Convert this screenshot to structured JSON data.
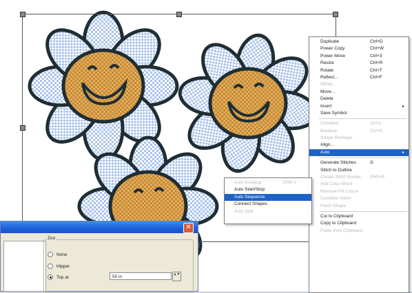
{
  "context_menu": {
    "items": [
      {
        "label": "Duplicate",
        "shortcut": "Ctrl+D",
        "disabled": false
      },
      {
        "label": "Power Copy",
        "shortcut": "Ctrl+W",
        "disabled": false
      },
      {
        "label": "Power Move",
        "shortcut": "Ctrl+3",
        "disabled": false
      },
      {
        "label": "Resize",
        "shortcut": "Ctrl+R",
        "disabled": false
      },
      {
        "label": "Rotate",
        "shortcut": "Ctrl+T",
        "disabled": false
      },
      {
        "label": "Reflect...",
        "shortcut": "Ctrl+F",
        "disabled": false
      },
      {
        "label": "Offset...",
        "shortcut": "",
        "disabled": true
      },
      {
        "label": "Move...",
        "shortcut": "",
        "disabled": false
      },
      {
        "label": "Delete",
        "shortcut": "",
        "disabled": false
      },
      {
        "label": "Insert",
        "shortcut": "",
        "disabled": false,
        "submenu": true
      },
      {
        "label": "Save Symbol",
        "shortcut": "",
        "disabled": false
      },
      {
        "separator": true
      },
      {
        "label": "Combine",
        "shortcut": "Ctrl+L",
        "disabled": true
      },
      {
        "label": "Breakup",
        "shortcut": "Ctrl+K",
        "disabled": true
      },
      {
        "label": "Shape Reshape",
        "shortcut": "",
        "disabled": true
      },
      {
        "label": "Align...",
        "shortcut": "",
        "disabled": false
      },
      {
        "label": "Auto",
        "shortcut": "",
        "disabled": false,
        "highlight": true,
        "submenu": true
      },
      {
        "separator": true
      },
      {
        "label": "Generate Stitches",
        "shortcut": "G",
        "disabled": false
      },
      {
        "label": "Stitch to Outline",
        "shortcut": "",
        "disabled": false
      },
      {
        "label": "Create Stitch Border",
        "shortcut": "Shift+B",
        "disabled": true
      },
      {
        "label": "Add Color Block",
        "shortcut": "",
        "disabled": true
      },
      {
        "label": "Remove Fill Colour",
        "shortcut": "",
        "disabled": true
      },
      {
        "label": "Combine Hatch",
        "shortcut": "",
        "disabled": true
      },
      {
        "label": "Patch Shape",
        "shortcut": "",
        "disabled": true
      },
      {
        "separator": true
      },
      {
        "label": "Cut to Clipboard",
        "shortcut": "",
        "disabled": false
      },
      {
        "label": "Copy to Clipboard",
        "shortcut": "",
        "disabled": false
      },
      {
        "label": "Paste from Clipboard",
        "shortcut": "",
        "disabled": true
      }
    ]
  },
  "submenu": {
    "items": [
      {
        "label": "Auto Breakup",
        "shortcut": "Shift+J",
        "disabled": true
      },
      {
        "label": "Auto Start/Stop",
        "shortcut": "",
        "disabled": false
      },
      {
        "label": "Auto Sequence",
        "shortcut": "",
        "disabled": false,
        "highlight": true
      },
      {
        "label": "Connect Shapes",
        "shortcut": "",
        "disabled": false
      },
      {
        "label": "Auto Split",
        "shortcut": "",
        "disabled": true
      }
    ]
  },
  "dialog": {
    "close_glyph": "✕",
    "zoom_legend": "Zoo",
    "options": [
      {
        "label": "None",
        "checked": false
      },
      {
        "label": "Hipper",
        "checked": false
      },
      {
        "label": "Top at",
        "checked": true
      }
    ],
    "zoom_value": "50 in",
    "spinner_glyph": "▲▼"
  },
  "colors": {
    "highlight": "#1c63c8",
    "petal_fill": "#b9d0ef",
    "face_fill": "#c98c3a",
    "outline": "#1f2e33"
  }
}
